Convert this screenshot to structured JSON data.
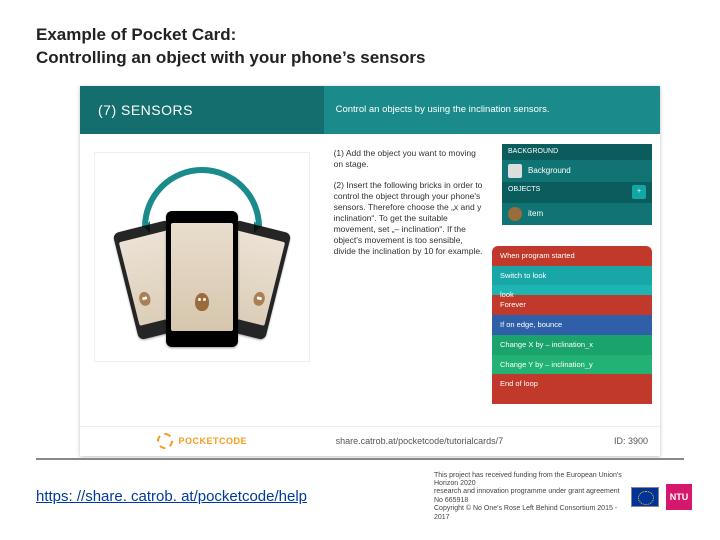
{
  "title_line1": "Example of Pocket Card:",
  "title_line2": "Controlling an object with your phone’s sensors",
  "card": {
    "header_left": "(7) SENSORS",
    "header_right": "Control an objects by using the inclination sensors.",
    "step1": "(1) Add the object you want to moving on stage.",
    "step2": "(2) Insert the following bricks in order to control the object through your phone's sensors. Therefore choose the „x and y inclination“. To get the suitable movement, set „– inclination“. If the object's movement is too sensible, divide the inclination by 10 for example.",
    "app": {
      "sec_back": "BACKGROUND",
      "row_back": "Background",
      "sec_obj": "OBJECTS",
      "row_obj": "item"
    },
    "bricks": {
      "b1": "When program started",
      "b2": "Switch to look",
      "b2sub": "look",
      "b3": "Forever",
      "b4": "If on edge, bounce",
      "b5": "Change X by   – inclination_x",
      "b6": "Change Y by   – inclination_y",
      "b7": "End of loop"
    },
    "brand": "POCKETCODE",
    "footer_url": "share.catrob.at/pocketcode/tutorialcards/7",
    "footer_id": "ID: 3900"
  },
  "link": "https: //share. catrob. at/pocketcode/help",
  "funding_line1": "This project has received funding from the European Union's Horizon 2020",
  "funding_line2": "research and innovation programme under grant agreement No 665918",
  "funding_line3": "Copyright © No One's Rose Left Behind Consortium   2015 - 2017",
  "ntu": "NTU"
}
